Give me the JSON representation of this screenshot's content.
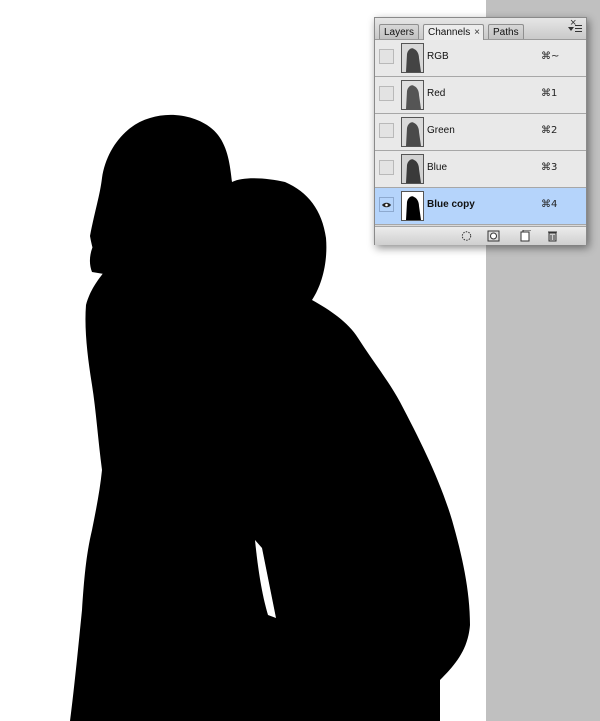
{
  "panel": {
    "tabs": [
      {
        "label": "Layers"
      },
      {
        "label": "Channels"
      },
      {
        "label": "Paths"
      }
    ],
    "close_glyph": "×",
    "tab_close_glyph": "×",
    "channels": [
      {
        "name": "RGB",
        "shortcut": "⌘~",
        "visible": false,
        "selected": false
      },
      {
        "name": "Red",
        "shortcut": "⌘1",
        "visible": false,
        "selected": false
      },
      {
        "name": "Green",
        "shortcut": "⌘2",
        "visible": false,
        "selected": false
      },
      {
        "name": "Blue",
        "shortcut": "⌘3",
        "visible": false,
        "selected": false
      },
      {
        "name": "Blue copy",
        "shortcut": "⌘4",
        "visible": true,
        "selected": true
      }
    ],
    "icons": [
      "eye-icon",
      "load-selection-icon",
      "save-selection-icon",
      "new-channel-icon",
      "trash-icon"
    ]
  },
  "colors": {
    "selected_row": "#b5d4fb",
    "background_gray": "#c0c0c0",
    "canvas": "#ffffff",
    "silhouette": "#000000"
  }
}
